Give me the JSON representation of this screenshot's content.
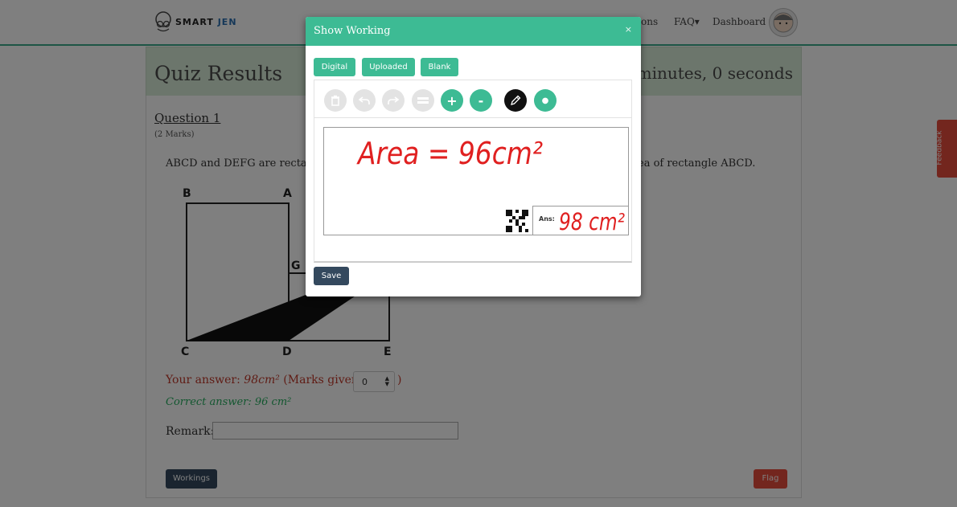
{
  "navbar": {
    "logo_smart": "SMART",
    "logo_jen": "JEN",
    "links": [
      "ons",
      "FAQ▾",
      "Dashboard"
    ]
  },
  "quiz": {
    "title": "Quiz Results",
    "timer": "minutes, 0 seconds",
    "question_title": "Question 1",
    "marks": "(2 Marks)",
    "text_left": "ABCD and DEFG are rectan",
    "text_right": "ea of rectangle ABCD.",
    "diagram_labels": {
      "b": "B",
      "a": "A",
      "g": "G",
      "c": "C",
      "d": "D",
      "e": "E"
    },
    "your_answer_prefix": "Your answer: ",
    "your_answer_value": "98cm²",
    "marks_given_label": " (Marks given:",
    "marks_given_value": "0",
    "close_paren": ")",
    "correct_answer": "Correct answer: 96 cm²",
    "remark_label": "Remark:",
    "workings_button": "Workings",
    "flag_button": "Flag",
    "feedback_tab": "Feedback"
  },
  "modal": {
    "title": "Show Working",
    "close": "×",
    "tabs": [
      "Digital",
      "Uploaded",
      "Blank"
    ],
    "tools": {
      "delete_icon": "trash-icon",
      "undo_icon": "undo-icon",
      "redo_icon": "redo-icon",
      "swap_icon": "swap-icon",
      "plus": "+",
      "minus": "-",
      "pencil_icon": "pencil-icon",
      "dot": "●"
    },
    "working_text": "Area = 96cm²",
    "ans_label": "Ans:",
    "ans_value": "98 cm²",
    "save_button": "Save"
  },
  "colors": {
    "accent": "#3dbb94",
    "dark_button": "#34495e",
    "danger": "#e74c3c",
    "handwriting": "#e02020"
  }
}
